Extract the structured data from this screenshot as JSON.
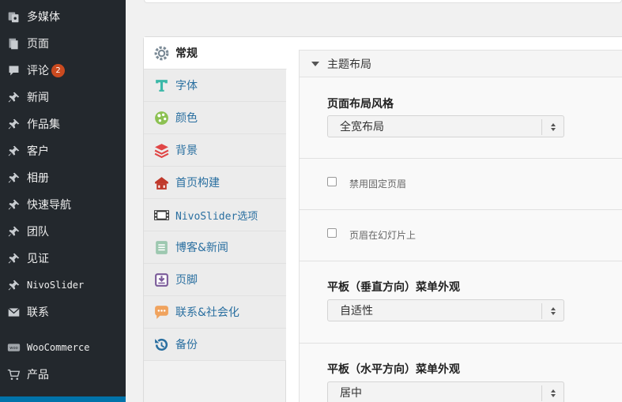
{
  "admin_menu": {
    "items": [
      {
        "label": "多媒体",
        "icon": "media-icon"
      },
      {
        "label": "页面",
        "icon": "page-icon"
      },
      {
        "label": "评论",
        "icon": "comment-icon",
        "badge": "2"
      },
      {
        "label": "新闻",
        "icon": "pin-icon"
      },
      {
        "label": "作品集",
        "icon": "pin-icon"
      },
      {
        "label": "客户",
        "icon": "pin-icon"
      },
      {
        "label": "相册",
        "icon": "pin-icon"
      },
      {
        "label": "快速导航",
        "icon": "pin-icon"
      },
      {
        "label": "团队",
        "icon": "pin-icon"
      },
      {
        "label": "见证",
        "icon": "pin-icon"
      },
      {
        "label": "NivoSlider",
        "icon": "pin-icon"
      },
      {
        "label": "联系",
        "icon": "mail-icon"
      },
      {
        "label": "WooCommerce",
        "icon": "woocommerce-icon"
      },
      {
        "label": "产品",
        "icon": "cart-icon"
      }
    ]
  },
  "options_tabs": [
    {
      "label": "常规",
      "icon": "gear-icon",
      "active": true
    },
    {
      "label": "字体",
      "icon": "typography-icon"
    },
    {
      "label": "颜色",
      "icon": "palette-icon"
    },
    {
      "label": "背景",
      "icon": "layers-icon"
    },
    {
      "label": "首页构建",
      "icon": "home-builder-icon"
    },
    {
      "label": "NivoSlider选项",
      "icon": "film-icon"
    },
    {
      "label": "博客&新闻",
      "icon": "document-icon"
    },
    {
      "label": "页脚",
      "icon": "footer-download-icon"
    },
    {
      "label": "联系&社会化",
      "icon": "speech-bubble-icon"
    },
    {
      "label": "备份",
      "icon": "backup-icon"
    }
  ],
  "section": {
    "title": "主题布局",
    "layout_style": {
      "title": "页面布局风格",
      "value": "全宽布局"
    },
    "disable_fixed_header": {
      "label": "禁用固定页眉"
    },
    "header_on_slider": {
      "label": "页眉在幻灯片上"
    },
    "tablet_vertical_menu": {
      "title": "平板（垂直方向）菜单外观",
      "value": "自适性"
    },
    "tablet_horizontal_menu": {
      "title": "平板（水平方向）菜单外观",
      "value": "居中"
    }
  },
  "colors": {
    "sidebar_bg": "#23282d",
    "accent_blue": "#0073aa",
    "badge": "#ca4a1f",
    "tab_link": "#2a6fa0"
  }
}
